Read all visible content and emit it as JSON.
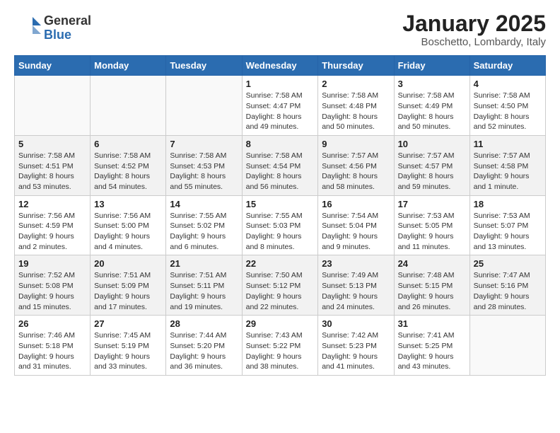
{
  "logo": {
    "general": "General",
    "blue": "Blue"
  },
  "header": {
    "month": "January 2025",
    "location": "Boschetto, Lombardy, Italy"
  },
  "weekdays": [
    "Sunday",
    "Monday",
    "Tuesday",
    "Wednesday",
    "Thursday",
    "Friday",
    "Saturday"
  ],
  "weeks": [
    [
      {
        "day": "",
        "info": ""
      },
      {
        "day": "",
        "info": ""
      },
      {
        "day": "",
        "info": ""
      },
      {
        "day": "1",
        "info": "Sunrise: 7:58 AM\nSunset: 4:47 PM\nDaylight: 8 hours\nand 49 minutes."
      },
      {
        "day": "2",
        "info": "Sunrise: 7:58 AM\nSunset: 4:48 PM\nDaylight: 8 hours\nand 50 minutes."
      },
      {
        "day": "3",
        "info": "Sunrise: 7:58 AM\nSunset: 4:49 PM\nDaylight: 8 hours\nand 50 minutes."
      },
      {
        "day": "4",
        "info": "Sunrise: 7:58 AM\nSunset: 4:50 PM\nDaylight: 8 hours\nand 52 minutes."
      }
    ],
    [
      {
        "day": "5",
        "info": "Sunrise: 7:58 AM\nSunset: 4:51 PM\nDaylight: 8 hours\nand 53 minutes."
      },
      {
        "day": "6",
        "info": "Sunrise: 7:58 AM\nSunset: 4:52 PM\nDaylight: 8 hours\nand 54 minutes."
      },
      {
        "day": "7",
        "info": "Sunrise: 7:58 AM\nSunset: 4:53 PM\nDaylight: 8 hours\nand 55 minutes."
      },
      {
        "day": "8",
        "info": "Sunrise: 7:58 AM\nSunset: 4:54 PM\nDaylight: 8 hours\nand 56 minutes."
      },
      {
        "day": "9",
        "info": "Sunrise: 7:57 AM\nSunset: 4:56 PM\nDaylight: 8 hours\nand 58 minutes."
      },
      {
        "day": "10",
        "info": "Sunrise: 7:57 AM\nSunset: 4:57 PM\nDaylight: 8 hours\nand 59 minutes."
      },
      {
        "day": "11",
        "info": "Sunrise: 7:57 AM\nSunset: 4:58 PM\nDaylight: 9 hours\nand 1 minute."
      }
    ],
    [
      {
        "day": "12",
        "info": "Sunrise: 7:56 AM\nSunset: 4:59 PM\nDaylight: 9 hours\nand 2 minutes."
      },
      {
        "day": "13",
        "info": "Sunrise: 7:56 AM\nSunset: 5:00 PM\nDaylight: 9 hours\nand 4 minutes."
      },
      {
        "day": "14",
        "info": "Sunrise: 7:55 AM\nSunset: 5:02 PM\nDaylight: 9 hours\nand 6 minutes."
      },
      {
        "day": "15",
        "info": "Sunrise: 7:55 AM\nSunset: 5:03 PM\nDaylight: 9 hours\nand 8 minutes."
      },
      {
        "day": "16",
        "info": "Sunrise: 7:54 AM\nSunset: 5:04 PM\nDaylight: 9 hours\nand 9 minutes."
      },
      {
        "day": "17",
        "info": "Sunrise: 7:53 AM\nSunset: 5:05 PM\nDaylight: 9 hours\nand 11 minutes."
      },
      {
        "day": "18",
        "info": "Sunrise: 7:53 AM\nSunset: 5:07 PM\nDaylight: 9 hours\nand 13 minutes."
      }
    ],
    [
      {
        "day": "19",
        "info": "Sunrise: 7:52 AM\nSunset: 5:08 PM\nDaylight: 9 hours\nand 15 minutes."
      },
      {
        "day": "20",
        "info": "Sunrise: 7:51 AM\nSunset: 5:09 PM\nDaylight: 9 hours\nand 17 minutes."
      },
      {
        "day": "21",
        "info": "Sunrise: 7:51 AM\nSunset: 5:11 PM\nDaylight: 9 hours\nand 19 minutes."
      },
      {
        "day": "22",
        "info": "Sunrise: 7:50 AM\nSunset: 5:12 PM\nDaylight: 9 hours\nand 22 minutes."
      },
      {
        "day": "23",
        "info": "Sunrise: 7:49 AM\nSunset: 5:13 PM\nDaylight: 9 hours\nand 24 minutes."
      },
      {
        "day": "24",
        "info": "Sunrise: 7:48 AM\nSunset: 5:15 PM\nDaylight: 9 hours\nand 26 minutes."
      },
      {
        "day": "25",
        "info": "Sunrise: 7:47 AM\nSunset: 5:16 PM\nDaylight: 9 hours\nand 28 minutes."
      }
    ],
    [
      {
        "day": "26",
        "info": "Sunrise: 7:46 AM\nSunset: 5:18 PM\nDaylight: 9 hours\nand 31 minutes."
      },
      {
        "day": "27",
        "info": "Sunrise: 7:45 AM\nSunset: 5:19 PM\nDaylight: 9 hours\nand 33 minutes."
      },
      {
        "day": "28",
        "info": "Sunrise: 7:44 AM\nSunset: 5:20 PM\nDaylight: 9 hours\nand 36 minutes."
      },
      {
        "day": "29",
        "info": "Sunrise: 7:43 AM\nSunset: 5:22 PM\nDaylight: 9 hours\nand 38 minutes."
      },
      {
        "day": "30",
        "info": "Sunrise: 7:42 AM\nSunset: 5:23 PM\nDaylight: 9 hours\nand 41 minutes."
      },
      {
        "day": "31",
        "info": "Sunrise: 7:41 AM\nSunset: 5:25 PM\nDaylight: 9 hours\nand 43 minutes."
      },
      {
        "day": "",
        "info": ""
      }
    ]
  ]
}
